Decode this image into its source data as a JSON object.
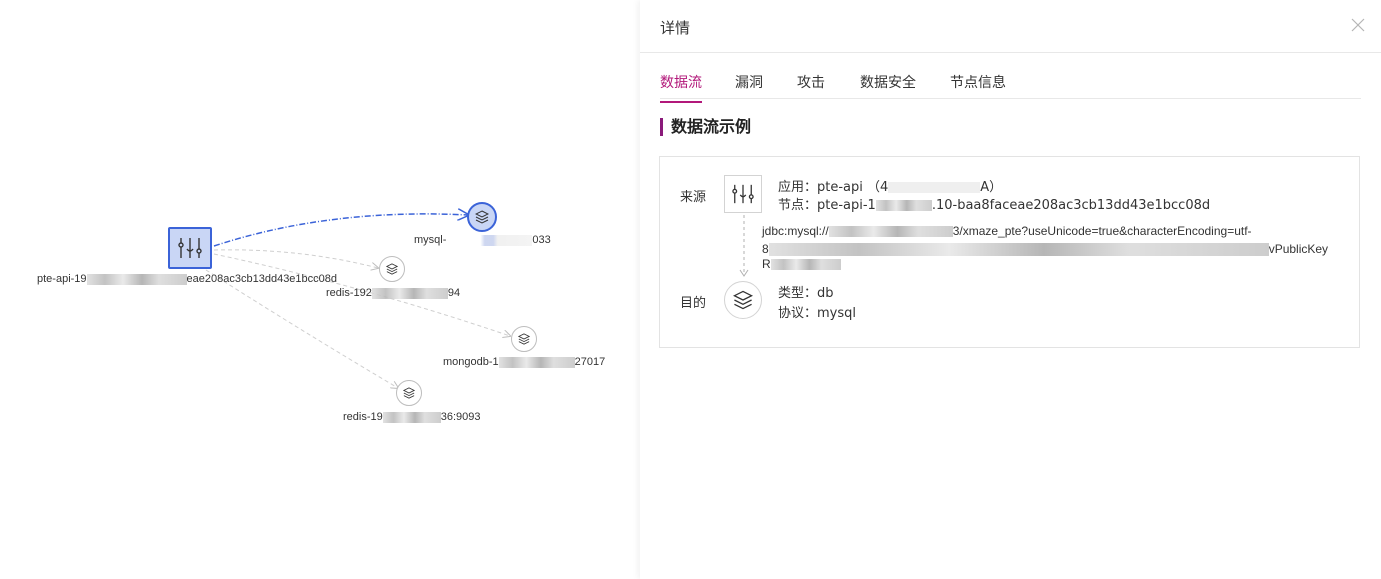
{
  "graph": {
    "source_node": {
      "label_prefix": "pte-api-19",
      "label_suffix": "eae208ac3cb13dd43e1bcc08d",
      "icon": "app-mixer-icon"
    },
    "targets": [
      {
        "label_prefix": "mysql-",
        "label_suffix": "033",
        "icon": "layers-icon",
        "active": true
      },
      {
        "label_prefix": "redis-192",
        "label_suffix": "94",
        "icon": "layers-icon",
        "active": false
      },
      {
        "label_prefix": "mongodb-1",
        "label_suffix": "27017",
        "icon": "layers-icon",
        "active": false
      },
      {
        "label_prefix": "redis-19",
        "label_suffix": "36:9093",
        "icon": "layers-icon",
        "active": false
      }
    ],
    "colors": {
      "active_link": "#3b63d8",
      "link": "#cfcfcf",
      "active_fill": "#c9d6f5"
    }
  },
  "panel": {
    "title": "详情",
    "close_icon": "close-icon",
    "tabs": [
      {
        "label": "数据流",
        "active": true
      },
      {
        "label": "漏洞",
        "active": false
      },
      {
        "label": "攻击",
        "active": false
      },
      {
        "label": "数据安全",
        "active": false
      },
      {
        "label": "节点信息",
        "active": false
      }
    ],
    "section_title": "数据流示例",
    "source": {
      "label": "来源",
      "app_prefix": "应用：pte-api （4",
      "app_suffix": "A）",
      "node_prefix": "节点：pte-api-1",
      "node_suffix": ".10-baa8faceae208ac3cb13dd43e1bcc08d"
    },
    "connection": {
      "line1_prefix": "jdbc:mysql://",
      "line1_suffix": "3/xmaze_pte?useUnicode=true&characterEncoding=utf-",
      "line2_prefix": "8",
      "line2_suffix": "vPublicKey",
      "line3_prefix": "R"
    },
    "target": {
      "label": "目的",
      "type": "类型：db",
      "protocol": "协议：mysql"
    },
    "colors": {
      "accent": "#b2187a",
      "section_bar": "#8a1a7a"
    }
  }
}
